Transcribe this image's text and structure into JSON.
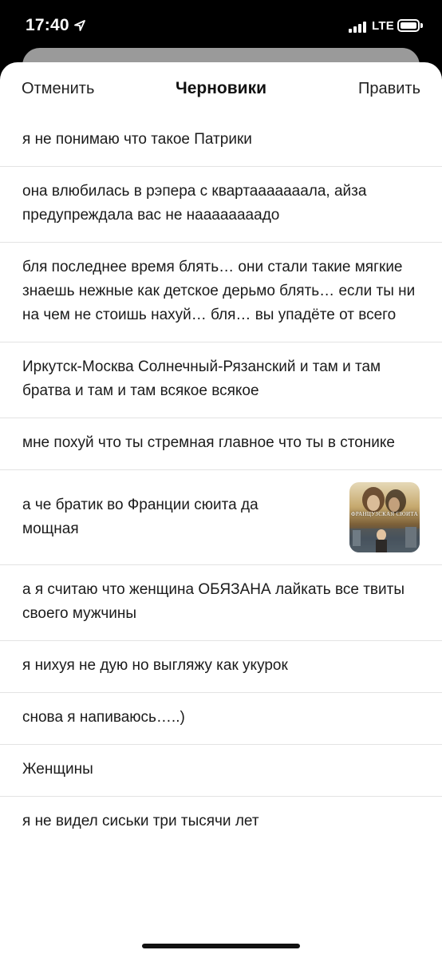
{
  "status_bar": {
    "time": "17:40",
    "network": "LTE",
    "icons": [
      "location-arrow-icon",
      "signal-bars-icon",
      "battery-icon"
    ]
  },
  "nav": {
    "cancel_label": "Отменить",
    "title": "Черновики",
    "edit_label": "Править"
  },
  "drafts": [
    {
      "text": "я не понимаю что такое Патрики"
    },
    {
      "text": "она влюбилась в рэпера с квартааааааала, айза предупреждала вас не наааааааадо"
    },
    {
      "text": "бля последнее время блять… они стали такие мягкие знаешь нежные как детское дерьмо блять…          если ты ни на чем не стоишь нахуй… бля… вы упадёте от всего"
    },
    {
      "text": "Иркутск-Москва Солнечный-Рязанский и там и там братва и там и там всякое всякое"
    },
    {
      "text": "мне похуй что ты стремная главное что ты в стонике"
    },
    {
      "text": "а че братик во Франции сюита да мощная",
      "thumbnail_caption": "ФРАНЦУЗСКАЯ СЮИТА"
    },
    {
      "text": "а я считаю что женщина ОБЯЗАНА лайкать все твиты своего мужчины"
    },
    {
      "text": "я нихуя не дую но выгляжу как укурок"
    },
    {
      "text": "снова я напиваюсь…..)"
    },
    {
      "text": "Женщины"
    },
    {
      "text": "я не видел сиськи три тысячи лет"
    }
  ]
}
